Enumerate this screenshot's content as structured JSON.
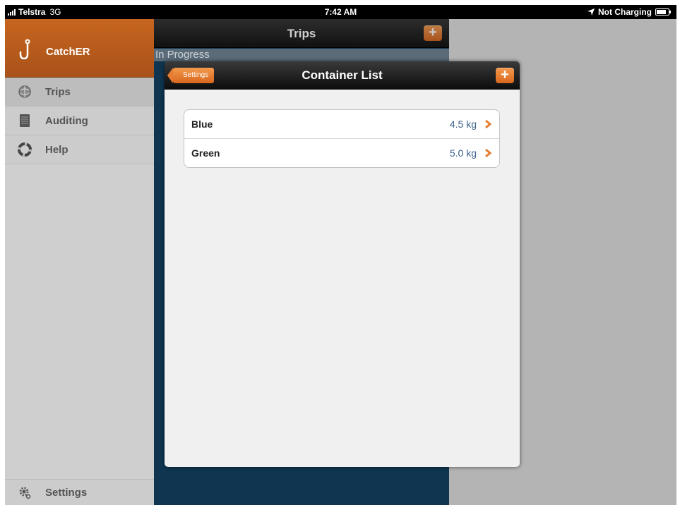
{
  "status_bar": {
    "carrier": "Telstra",
    "network": "3G",
    "time": "7:42 AM",
    "charging": "Not Charging"
  },
  "sidebar": {
    "brand": "CatchER",
    "items": [
      {
        "label": "Trips",
        "icon": "globe-icon"
      },
      {
        "label": "Auditing",
        "icon": "document-icon"
      },
      {
        "label": "Help",
        "icon": "lifebuoy-icon"
      }
    ],
    "settings_label": "Settings"
  },
  "trips_panel": {
    "title": "Trips",
    "add_label": "+",
    "section": "In Progress"
  },
  "modal": {
    "title": "Container List",
    "back_label": "Settings",
    "add_label": "+",
    "rows": [
      {
        "name": "Blue",
        "weight": "4.5 kg"
      },
      {
        "name": "Green",
        "weight": "5.0 kg"
      }
    ]
  },
  "colors": {
    "accent": "#e57c32",
    "brand_bg": "#b85b1c",
    "value_text": "#3a5f8a"
  }
}
